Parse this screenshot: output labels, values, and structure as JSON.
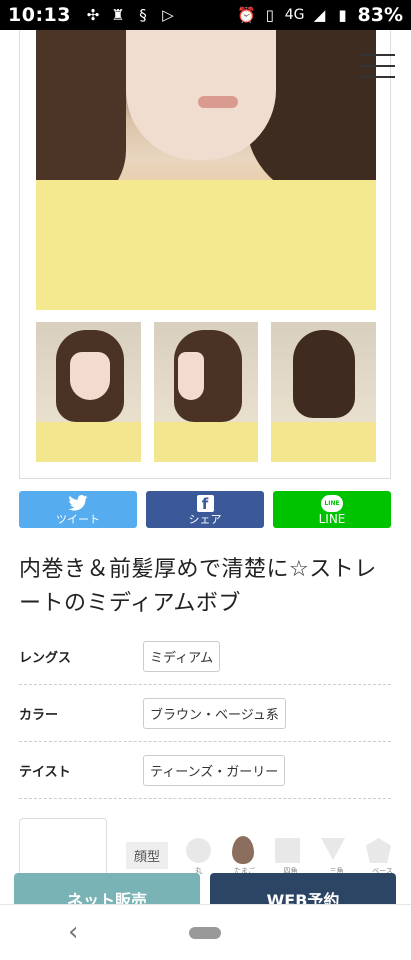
{
  "status_bar": {
    "time": "10:13",
    "network": "4G",
    "battery": "83%",
    "left_icons": [
      "pinwheel-icon",
      "shield-crown-icon",
      "s-icon",
      "play-triangle-icon"
    ],
    "right_icons": [
      "alarm-icon",
      "vibrate-icon",
      "signal-icon",
      "battery-icon"
    ]
  },
  "menu": {
    "icon": "hamburger-menu-icon"
  },
  "share": {
    "twitter_label": "ツイート",
    "facebook_label": "シェア",
    "facebook_glyph": "f",
    "line_label": "LINE",
    "line_glyph": "LINE",
    "colors": {
      "twitter": "#55acee",
      "facebook": "#3b5998",
      "line": "#00c300"
    }
  },
  "style_title": "内巻き＆前髪厚めで清楚に☆ストレートのミディアムボブ",
  "attributes": [
    {
      "label": "レングス",
      "value": "ミディアム"
    },
    {
      "label": "カラー",
      "value": "ブラウン・ベージュ系"
    },
    {
      "label": "テイスト",
      "value": "ティーンズ・ガーリー"
    }
  ],
  "face_type": {
    "label": "顔型",
    "shapes": [
      "丸",
      "たまご",
      "四角",
      "三角",
      "ベース"
    ],
    "selected": "たまご"
  },
  "cta": {
    "net_label": "ネット販売",
    "web_label": "WEB予約",
    "colors": {
      "net": "#7ab3b5",
      "web": "#2d4564"
    }
  },
  "nav": {
    "back_icon": "chevron-left-icon",
    "home_icon": "home-pill-icon"
  }
}
